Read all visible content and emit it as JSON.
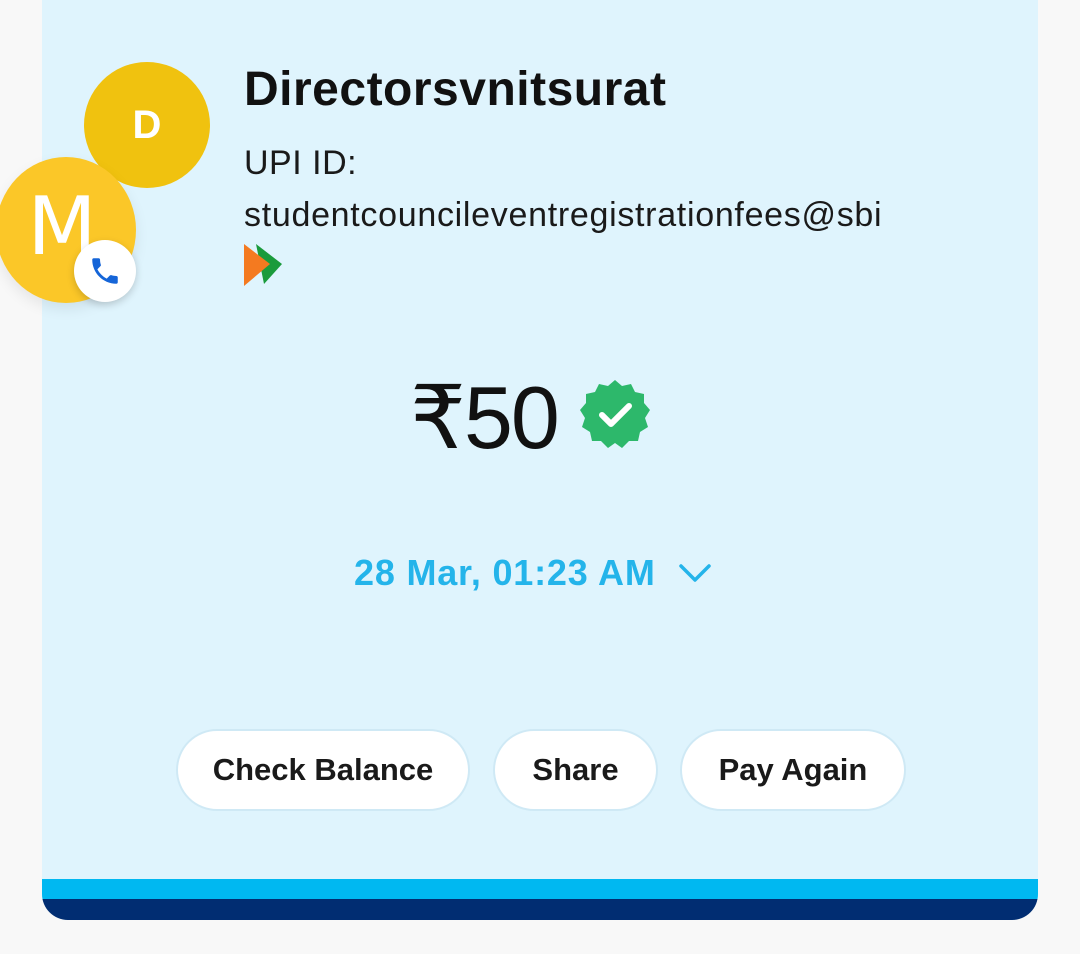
{
  "payee": {
    "name": "Directorsvnitsurat",
    "avatar_letter": "D",
    "avatar_color": "#f0c20f",
    "upi_id_label": "UPI ID:",
    "upi_id": "studentcouncileventregistrationfees@sbi"
  },
  "contact": {
    "avatar_letter": "M",
    "avatar_color": "#fbc728",
    "badge_icon": "phone-icon"
  },
  "payment": {
    "amount": "₹50",
    "status_icon": "verified-check-icon",
    "status_color": "#2db86b",
    "datetime": "28 Mar, 01:23 AM"
  },
  "actions": {
    "check_balance": "Check Balance",
    "share": "Share",
    "pay_again": "Pay Again"
  },
  "theme": {
    "card_bg": "#dff4fd",
    "accent": "#24b4ea",
    "stripe_light": "#00b8f1",
    "stripe_dark": "#012d72"
  }
}
